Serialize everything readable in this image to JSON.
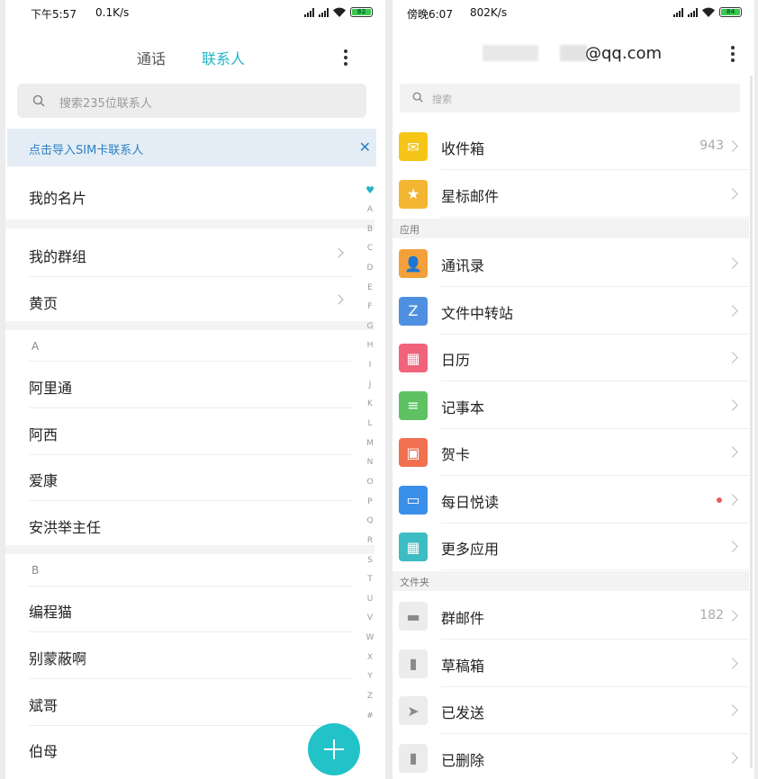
{
  "left": {
    "status": {
      "time": "下午5:57",
      "speed": "0.1K/s",
      "battery": "82"
    },
    "tabs": {
      "calls": "通话",
      "contacts": "联系人"
    },
    "search": {
      "placeholder": "搜索235位联系人"
    },
    "sim_banner": {
      "text": "点击导入SIM卡联系人",
      "close": "✕"
    },
    "my_card": "我的名片",
    "groups": {
      "my_groups": "我的群组",
      "yellow_pages": "黄页"
    },
    "sections": [
      {
        "letter": "A",
        "contacts": [
          "阿里通",
          "阿西",
          "爱康",
          "安洪举主任"
        ]
      },
      {
        "letter": "B",
        "contacts": [
          "编程猫",
          "别蒙蔽啊",
          "斌哥",
          "伯母"
        ]
      }
    ],
    "alphabet": [
      "♥",
      "A",
      "B",
      "C",
      "D",
      "E",
      "F",
      "G",
      "H",
      "I",
      "J",
      "K",
      "L",
      "M",
      "N",
      "O",
      "P",
      "Q",
      "R",
      "S",
      "T",
      "U",
      "V",
      "W",
      "X",
      "Y",
      "Z",
      "#"
    ]
  },
  "right": {
    "status": {
      "time": "傍晚6:07",
      "speed": "802K/s",
      "battery": "84"
    },
    "account_suffix": "@qq.com",
    "search": {
      "placeholder": "搜索"
    },
    "mailboxes": [
      {
        "label": "收件箱",
        "count": "943",
        "icon": "inbox-icon",
        "color": "#f5c518"
      },
      {
        "label": "星标邮件",
        "count": "",
        "icon": "star-icon",
        "color": "#f2b632"
      }
    ],
    "apps_header": "应用",
    "apps": [
      {
        "label": "通讯录",
        "icon": "contacts-book-icon",
        "color": "#f4a03a"
      },
      {
        "label": "文件中转站",
        "icon": "file-transfer-icon",
        "color": "#4f8fe0"
      },
      {
        "label": "日历",
        "icon": "calendar-icon",
        "color": "#f0637a"
      },
      {
        "label": "记事本",
        "icon": "notepad-icon",
        "color": "#5ec263"
      },
      {
        "label": "贺卡",
        "icon": "greeting-card-icon",
        "color": "#f0704f"
      },
      {
        "label": "每日悦读",
        "icon": "daily-reading-icon",
        "color": "#3a8fe8",
        "dot": true
      },
      {
        "label": "更多应用",
        "icon": "more-apps-icon",
        "color": "#3cbcc3"
      }
    ],
    "folders_header": "文件夹",
    "folders": [
      {
        "label": "群邮件",
        "count": "182",
        "icon": "folder-icon"
      },
      {
        "label": "草稿箱",
        "count": "",
        "icon": "draft-icon"
      },
      {
        "label": "已发送",
        "count": "",
        "icon": "sent-icon"
      },
      {
        "label": "已删除",
        "count": "",
        "icon": "trash-icon"
      }
    ]
  }
}
